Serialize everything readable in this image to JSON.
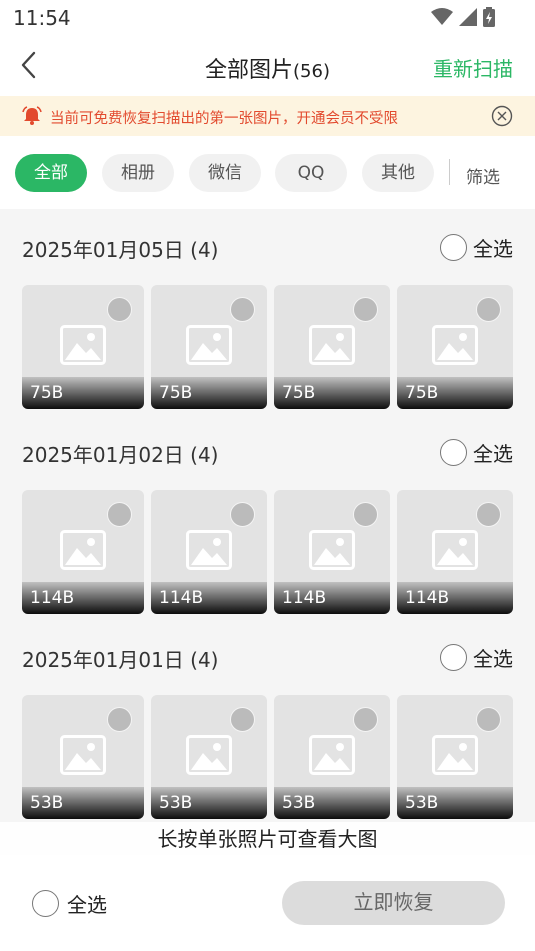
{
  "status_bar": {
    "time": "11:54"
  },
  "header": {
    "title": "全部图片",
    "count": "(56)",
    "rescan_label": "重新扫描"
  },
  "notice": {
    "text": "当前可免费恢复扫描出的第一张图片，开通会员不受限"
  },
  "filters": {
    "tabs": [
      {
        "label": "全部",
        "active": true
      },
      {
        "label": "相册",
        "active": false
      },
      {
        "label": "微信",
        "active": false
      },
      {
        "label": "QQ",
        "active": false
      },
      {
        "label": "其他",
        "active": false
      }
    ],
    "more_label": "筛选"
  },
  "groups": [
    {
      "date": "2025年01月05日 (4)",
      "select_all_label": "全选",
      "sizes": [
        "75B",
        "75B",
        "75B",
        "75B"
      ]
    },
    {
      "date": "2025年01月02日 (4)",
      "select_all_label": "全选",
      "sizes": [
        "114B",
        "114B",
        "114B",
        "114B"
      ]
    },
    {
      "date": "2025年01月01日 (4)",
      "select_all_label": "全选",
      "sizes": [
        "53B",
        "53B",
        "53B",
        "53B"
      ]
    }
  ],
  "hint": "长按单张照片可查看大图",
  "bottom_bar": {
    "select_all_label": "全选",
    "recover_label": "立即恢复"
  },
  "colors": {
    "accent": "#2bb765",
    "notice_text": "#e24a2e",
    "notice_bg": "#fdf4e0"
  }
}
